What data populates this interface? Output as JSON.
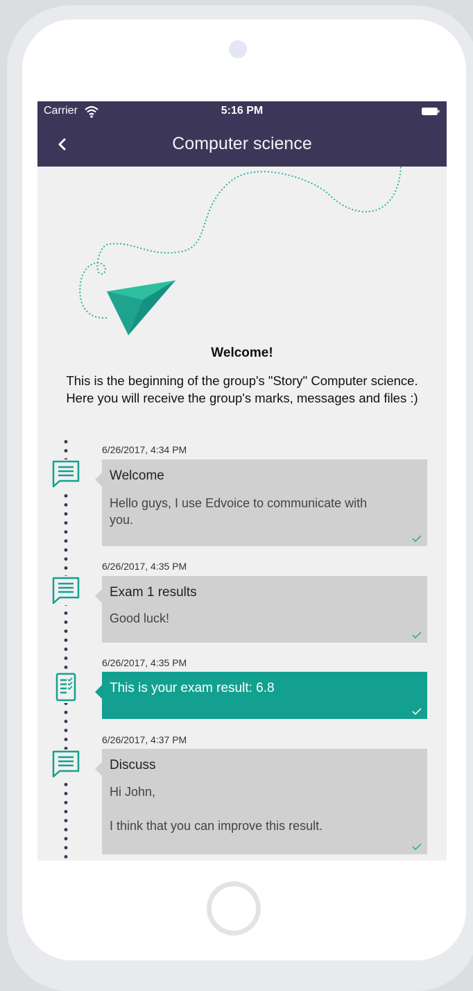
{
  "status_bar": {
    "carrier": "Carrier",
    "time": "5:16 PM"
  },
  "nav": {
    "title": "Computer science"
  },
  "welcome": {
    "title": "Welcome!",
    "line1": "This is the beginning of the group's \"Story\" Computer science.",
    "line2": "Here you will receive the group's marks, messages and files :)"
  },
  "timeline": [
    {
      "timestamp": "6/26/2017, 4:34 PM",
      "title": "Welcome",
      "body1": "Hello guys, I use Edvoice to communicate with",
      "body2": "you.",
      "icon": "message-icon"
    },
    {
      "timestamp": "6/26/2017, 4:35 PM",
      "title": "Exam 1 results",
      "body1": "Good luck!",
      "icon": "message-icon"
    },
    {
      "timestamp": "6/26/2017, 4:35 PM",
      "title": "This is your exam result: 6.8",
      "icon": "checklist-icon"
    },
    {
      "timestamp": "6/26/2017, 4:37 PM",
      "title": "Discuss",
      "body1": "Hi John,",
      "body2": "I think that you can improve this result.",
      "icon": "message-icon"
    }
  ],
  "colors": {
    "header": "#3c3658",
    "accent": "#14a090",
    "card": "#d0d0d0",
    "background": "#f0f0f0"
  }
}
